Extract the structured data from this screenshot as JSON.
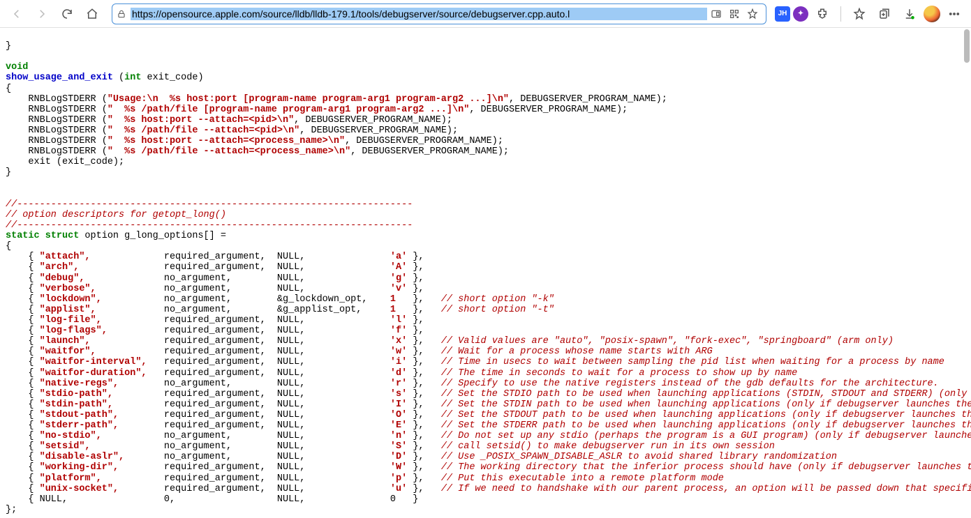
{
  "url": "https://opensource.apple.com/source/lldb/lldb-179.1/tools/debugserver/source/debugserver.cpp.auto.l",
  "ext_jh": "JH",
  "code": {
    "l0": "}",
    "l1": "",
    "kw_void": "void",
    "fn_name": "show_usage_and_exit",
    "sig_open": " (",
    "kw_int": "int",
    "sig_rest": " exit_code)",
    "brace_open": "{",
    "pre_rnb": "    RNBLogSTDERR (",
    "s_usage1": "\"Usage:\\n  %s host:port [program-name program-arg1 program-arg2 ...]\\n\"",
    "post_usage1": ", DEBUGSERVER_PROGRAM_NAME);",
    "s_usage2a": "\"  %s /path/file [program-name program-arg1 program-arg2 ...]\\n\"",
    "s_usage2b": "\"  %s host:port --attach=<pid>\\n\"",
    "s_usage2c": "\"  %s /path/file --attach=<pid>\\n\"",
    "s_usage2d": "\"  %s host:port --attach=<process_name>\\n\"",
    "s_usage2e": "\"  %s /path/file --attach=<process_name>\\n\"",
    "exit_line": "    exit (exit_code);",
    "brace_close": "}",
    "cmt_dashes": "//----------------------------------------------------------------------",
    "cmt_desc": "// option descriptors for getopt_long()",
    "kw_static": "static",
    "kw_struct": "struct",
    "opt_decl": " option g_long_options[] =",
    "opts": [
      {
        "n": "\"attach\"",
        "a": "required_argument,",
        "p": "NULL,",
        "c": "'a'",
        "cm": ""
      },
      {
        "n": "\"arch\"",
        "a": "required_argument,",
        "p": "NULL,",
        "c": "'A'",
        "cm": ""
      },
      {
        "n": "\"debug\"",
        "a": "no_argument,",
        "p": "NULL,",
        "c": "'g'",
        "cm": ""
      },
      {
        "n": "\"verbose\"",
        "a": "no_argument,",
        "p": "NULL,",
        "c": "'v'",
        "cm": ""
      },
      {
        "n": "\"lockdown\"",
        "a": "no_argument,",
        "p": "&g_lockdown_opt,",
        "c": "1  ",
        "cm": "// short option \"-k\""
      },
      {
        "n": "\"applist\"",
        "a": "no_argument,",
        "p": "&g_applist_opt,",
        "c": "1  ",
        "cm": "// short option \"-t\""
      },
      {
        "n": "\"log-file\"",
        "a": "required_argument,",
        "p": "NULL,",
        "c": "'l'",
        "cm": ""
      },
      {
        "n": "\"log-flags\"",
        "a": "required_argument,",
        "p": "NULL,",
        "c": "'f'",
        "cm": ""
      },
      {
        "n": "\"launch\"",
        "a": "required_argument,",
        "p": "NULL,",
        "c": "'x'",
        "cm": "// Valid values are \"auto\", \"posix-spawn\", \"fork-exec\", \"springboard\" (arm only)"
      },
      {
        "n": "\"waitfor\"",
        "a": "required_argument,",
        "p": "NULL,",
        "c": "'w'",
        "cm": "// Wait for a process whose name starts with ARG"
      },
      {
        "n": "\"waitfor-interval\"",
        "a": "required_argument,",
        "p": "NULL,",
        "c": "'i'",
        "cm": "// Time in usecs to wait between sampling the pid list when waiting for a process by name"
      },
      {
        "n": "\"waitfor-duration\"",
        "a": "required_argument,",
        "p": "NULL,",
        "c": "'d'",
        "cm": "// The time in seconds to wait for a process to show up by name"
      },
      {
        "n": "\"native-regs\"",
        "a": "no_argument,",
        "p": "NULL,",
        "c": "'r'",
        "cm": "// Specify to use the native registers instead of the gdb defaults for the architecture."
      },
      {
        "n": "\"stdio-path\"",
        "a": "required_argument,",
        "p": "NULL,",
        "c": "'s'",
        "cm": "// Set the STDIO path to be used when launching applications (STDIN, STDOUT and STDERR) (only if det"
      },
      {
        "n": "\"stdin-path\"",
        "a": "required_argument,",
        "p": "NULL,",
        "c": "'I'",
        "cm": "// Set the STDIN path to be used when launching applications (only if debugserver launches the proce"
      },
      {
        "n": "\"stdout-path\"",
        "a": "required_argument,",
        "p": "NULL,",
        "c": "'O'",
        "cm": "// Set the STDOUT path to be used when launching applications (only if debugserver launches the proc"
      },
      {
        "n": "\"stderr-path\"",
        "a": "required_argument,",
        "p": "NULL,",
        "c": "'E'",
        "cm": "// Set the STDERR path to be used when launching applications (only if debugserver launches the proc"
      },
      {
        "n": "\"no-stdio\"",
        "a": "no_argument,",
        "p": "NULL,",
        "c": "'n'",
        "cm": "// Do not set up any stdio (perhaps the program is a GUI program) (only if debugserver launches the"
      },
      {
        "n": "\"setsid\"",
        "a": "no_argument,",
        "p": "NULL,",
        "c": "'S'",
        "cm": "// call setsid() to make debugserver run in its own session"
      },
      {
        "n": "\"disable-aslr\"",
        "a": "no_argument,",
        "p": "NULL,",
        "c": "'D'",
        "cm": "// Use _POSIX_SPAWN_DISABLE_ASLR to avoid shared library randomization"
      },
      {
        "n": "\"working-dir\"",
        "a": "required_argument,",
        "p": "NULL,",
        "c": "'W'",
        "cm": "// The working directory that the inferior process should have (only if debugserver launches the pro"
      },
      {
        "n": "\"platform\"",
        "a": "required_argument,",
        "p": "NULL,",
        "c": "'p'",
        "cm": "// Put this executable into a remote platform mode"
      },
      {
        "n": "\"unix-socket\"",
        "a": "required_argument,",
        "p": "NULL,",
        "c": "'u'",
        "cm": "// If we need to handshake with our parent process, an option will be passed down that specifies a u"
      }
    ],
    "opt_null": "    { NULL,                 0,                  NULL,               0   }",
    "arr_close": "};"
  }
}
